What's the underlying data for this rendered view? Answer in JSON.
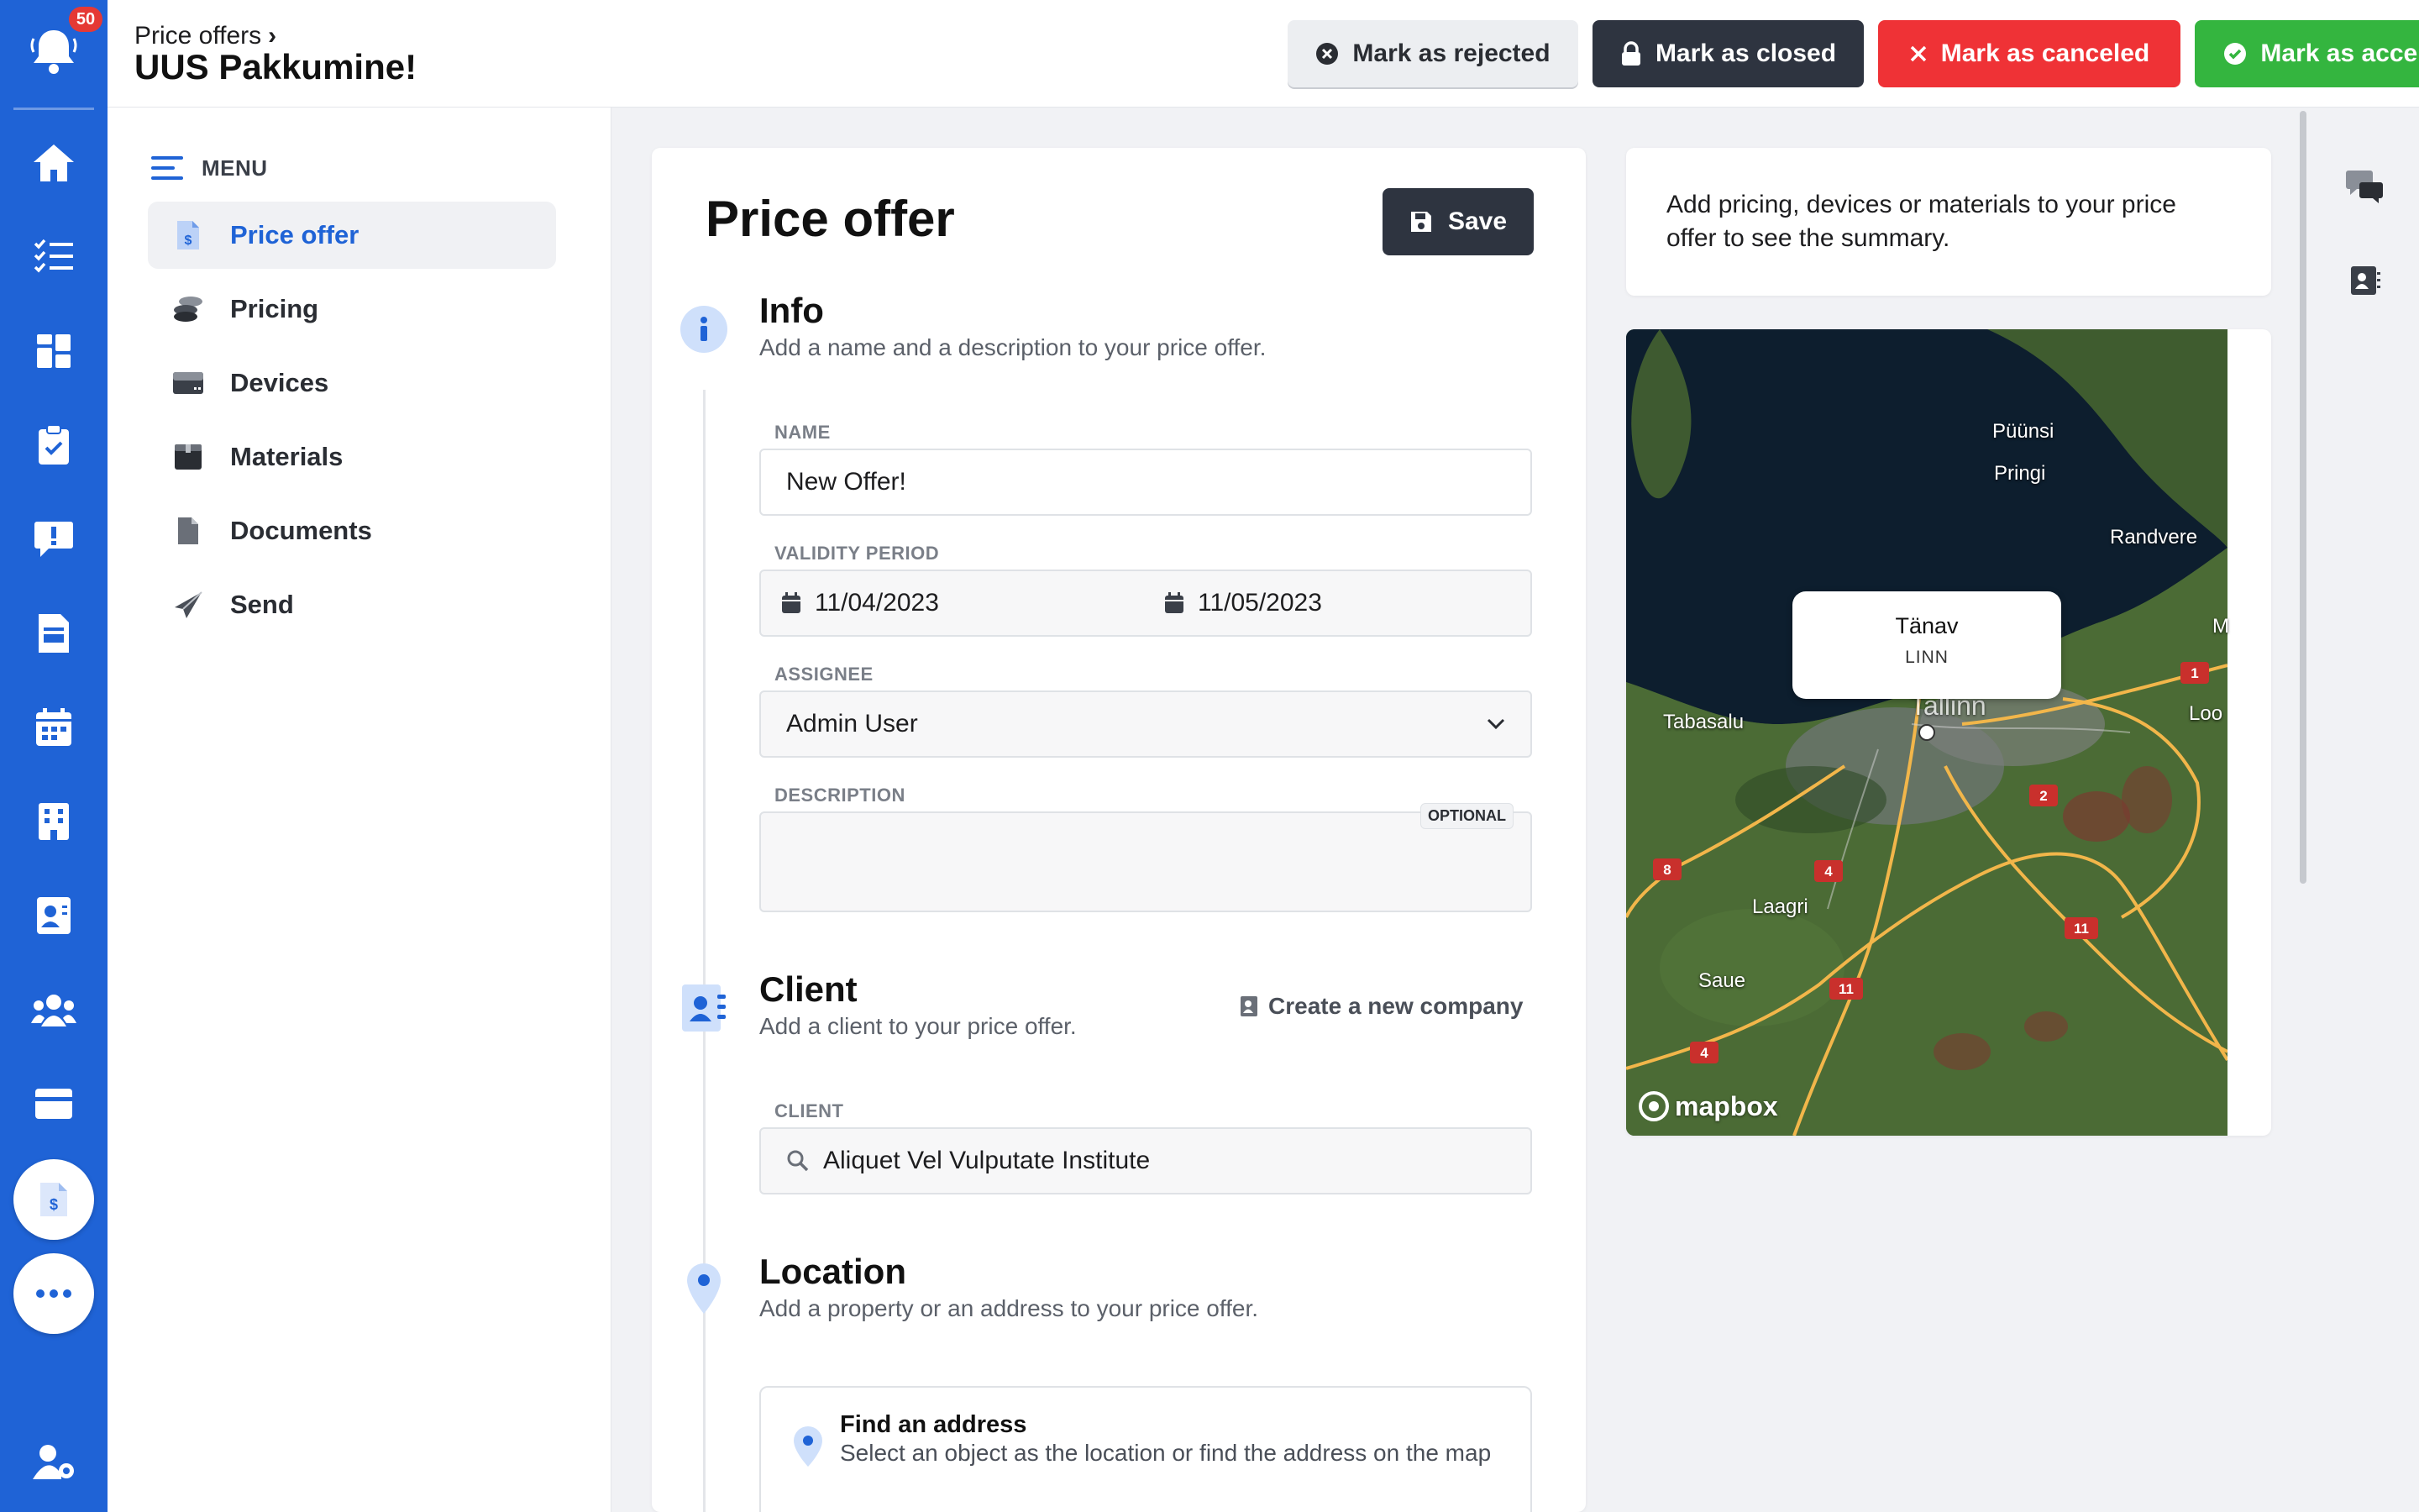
{
  "notifications": {
    "badge": "50"
  },
  "header": {
    "breadcrumb": "Price offers",
    "title": "UUS Pakkumine!",
    "actions": {
      "rejected": "Mark as rejected",
      "closed": "Mark as closed",
      "canceled": "Mark as canceled",
      "accepted": "Mark as accepted"
    }
  },
  "menu": {
    "heading": "MENU",
    "items": [
      {
        "label": "Price offer",
        "icon": "price-offer-icon"
      },
      {
        "label": "Pricing",
        "icon": "coins-icon"
      },
      {
        "label": "Devices",
        "icon": "device-icon"
      },
      {
        "label": "Materials",
        "icon": "box-icon"
      },
      {
        "label": "Documents",
        "icon": "document-icon"
      },
      {
        "label": "Send",
        "icon": "send-icon"
      }
    ]
  },
  "form": {
    "title": "Price offer",
    "save_label": "Save",
    "info": {
      "title": "Info",
      "subtitle": "Add a name and a description to your price offer.",
      "name_label": "NAME",
      "name_value": "New Offer!",
      "validity_label": "VALIDITY PERIOD",
      "date_from": "11/04/2023",
      "date_to": "11/05/2023",
      "assignee_label": "ASSIGNEE",
      "assignee_value": "Admin User",
      "description_label": "DESCRIPTION",
      "optional_badge": "OPTIONAL"
    },
    "client": {
      "title": "Client",
      "subtitle": "Add a client to your price offer.",
      "create_link": "Create a new company",
      "client_label": "CLIENT",
      "client_value": "Aliquet Vel Vulputate Institute"
    },
    "location": {
      "title": "Location",
      "subtitle": "Add a property or an address to your price offer.",
      "find_title": "Find an address",
      "find_sub": "Select an object as the location or find the address on the map"
    }
  },
  "summary": {
    "text": "Add pricing, devices or materials to your price offer to see the summary."
  },
  "map": {
    "popup_title": "Tänav",
    "popup_sub": "LINN",
    "labels": {
      "puunsi": "Püünsi",
      "pringi": "Pringi",
      "randvere": "Randvere",
      "tabasalu": "Tabasalu",
      "laagri": "Laagri",
      "saue": "Saue",
      "loo": "Loo",
      "m": "M",
      "tallinn": "Tallinn"
    },
    "road_numbers": [
      "1",
      "2",
      "4",
      "8",
      "11",
      "11",
      "4"
    ],
    "logo": "mapbox"
  },
  "colors": {
    "primary": "#1f63d6",
    "dark": "#2e3440",
    "danger": "#ef3236",
    "success": "#34b53f"
  }
}
